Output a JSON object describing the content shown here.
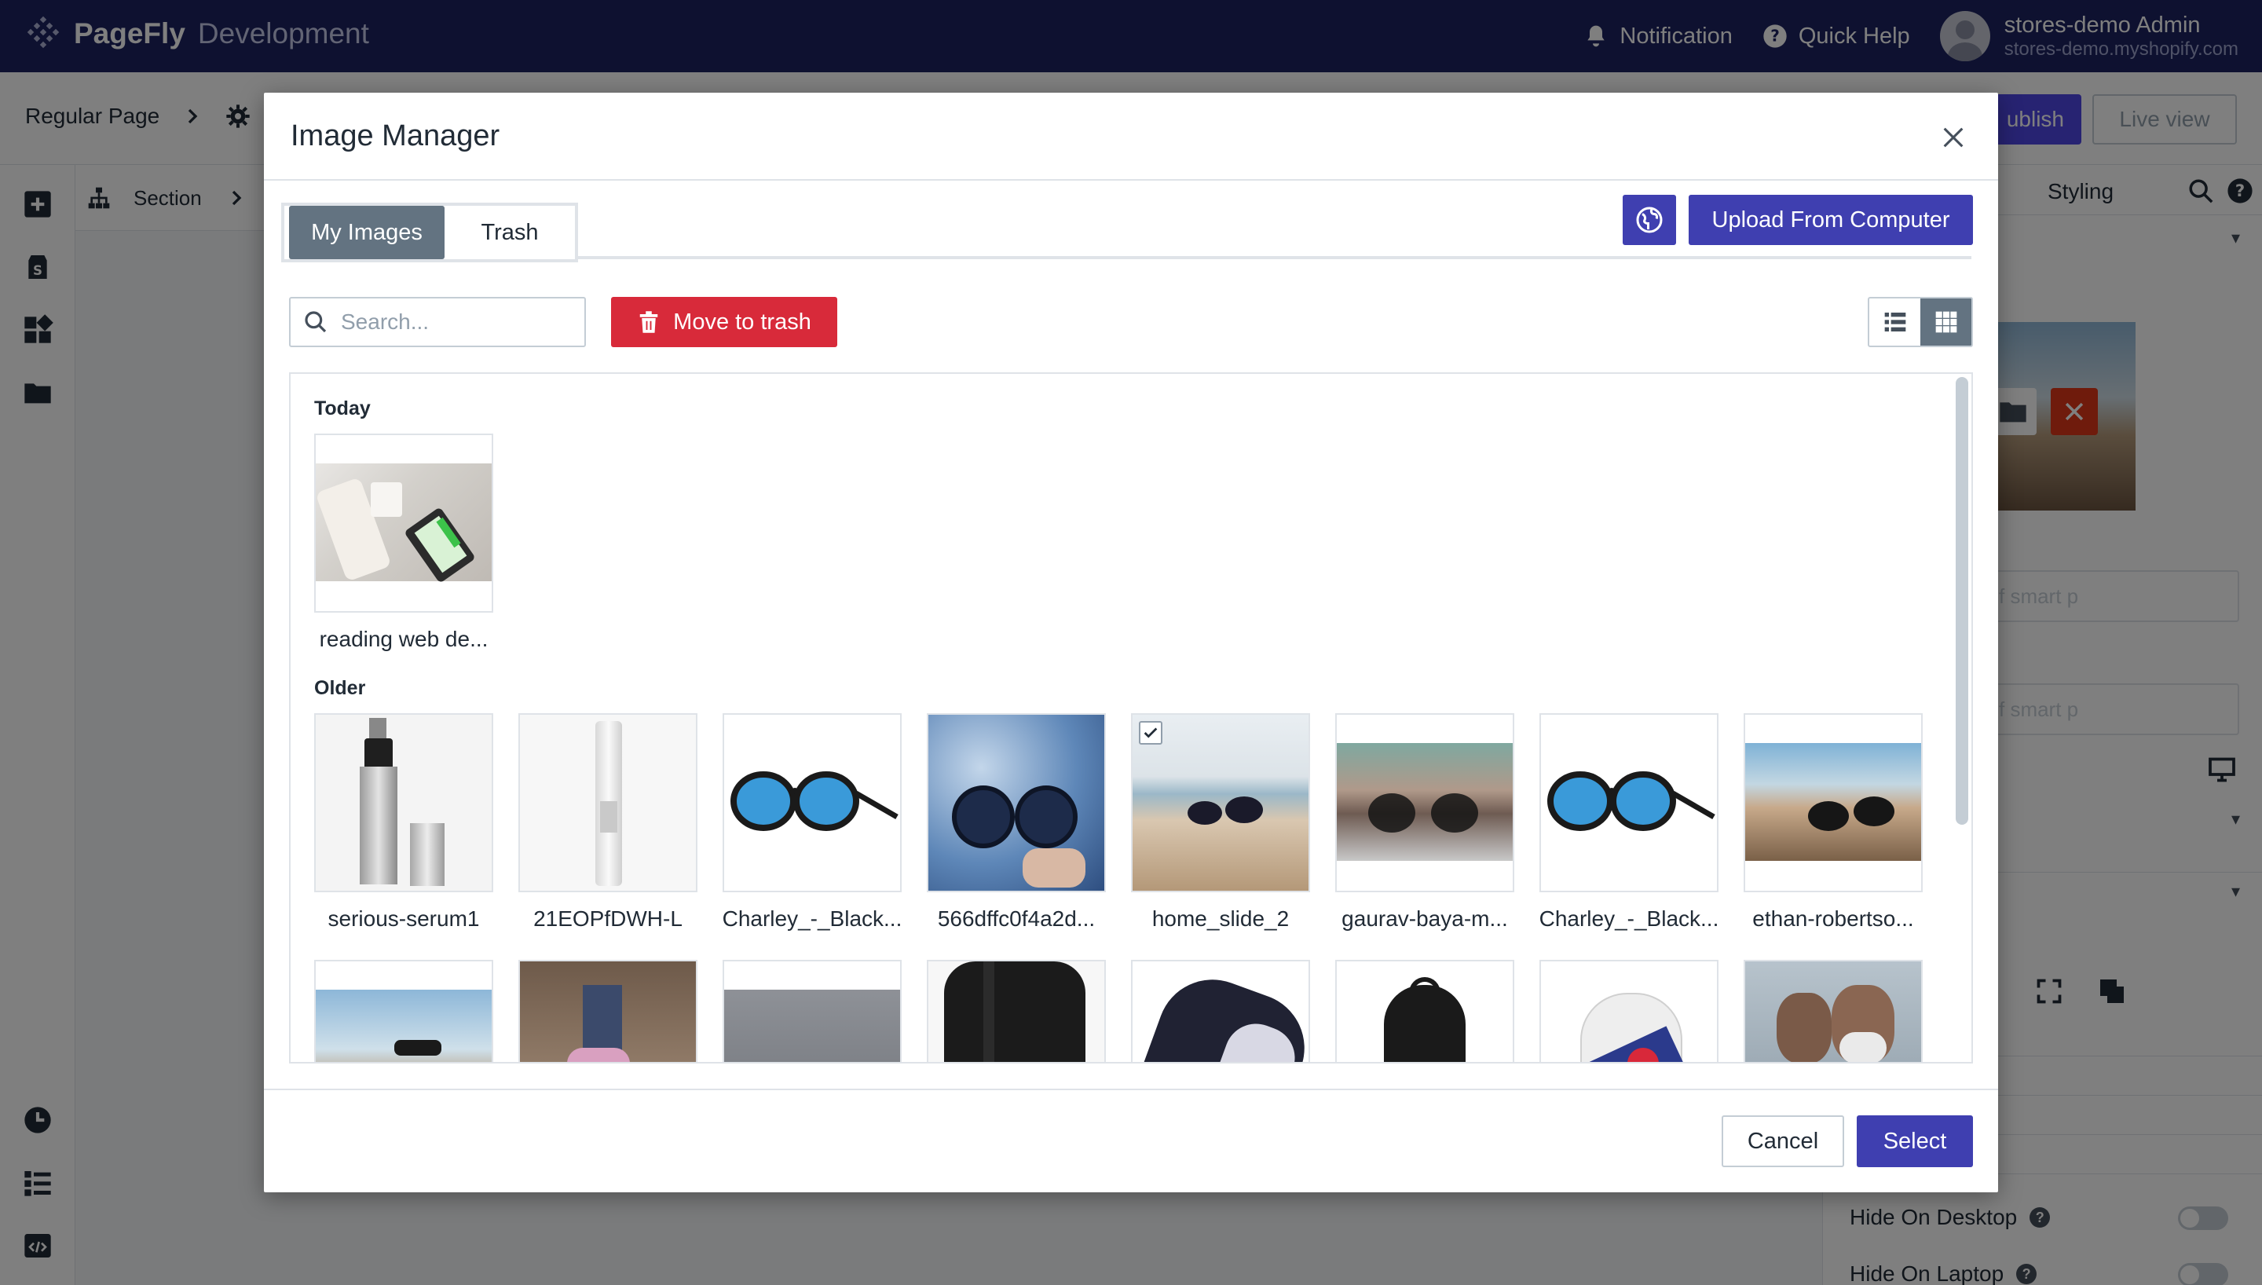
{
  "app": {
    "brand": "PageFly",
    "environment": "Development",
    "notification_label": "Notification",
    "quick_help_label": "Quick Help",
    "user_name": "stores-demo Admin",
    "user_store": "stores-demo.myshopify.com"
  },
  "editor": {
    "page_type": "Regular Page",
    "section_label": "Section",
    "publish_label": "ublish",
    "live_view_label": "Live view",
    "styling_tab": "Styling",
    "input_placeholder_1": "ell on all kind of smart p",
    "input_placeholder_2": "ell on all kind of smart p",
    "hide_desktop_label": "Hide On Desktop",
    "hide_laptop_label": "Hide On Laptop"
  },
  "modal": {
    "title": "Image Manager",
    "tabs": [
      {
        "label": "My Images",
        "active": true
      },
      {
        "label": "Trash",
        "active": false
      }
    ],
    "upload_label": "Upload From Computer",
    "search_placeholder": "Search...",
    "move_to_trash_label": "Move to trash",
    "view_mode": "grid",
    "groups": [
      {
        "label": "Today"
      },
      {
        "label": "Older"
      }
    ],
    "today_images": [
      {
        "name": "reading web de...",
        "checked": false
      }
    ],
    "older_images": [
      {
        "name": "serious-serum1",
        "checked": false
      },
      {
        "name": "21EOPfDWH-L",
        "checked": false
      },
      {
        "name": "Charley_-_Black...",
        "checked": false
      },
      {
        "name": "566dffc0f4a2d...",
        "checked": false
      },
      {
        "name": "home_slide_2",
        "checked": true
      },
      {
        "name": "gaurav-baya-m...",
        "checked": false
      },
      {
        "name": "Charley_-_Black...",
        "checked": false
      },
      {
        "name": "ethan-robertso...",
        "checked": false
      }
    ],
    "cancel_label": "Cancel",
    "select_label": "Select"
  },
  "colors": {
    "topbar": "#1c2260",
    "primary": "#3f3fb0",
    "danger": "#d82a3a",
    "tab_active": "#637381"
  }
}
